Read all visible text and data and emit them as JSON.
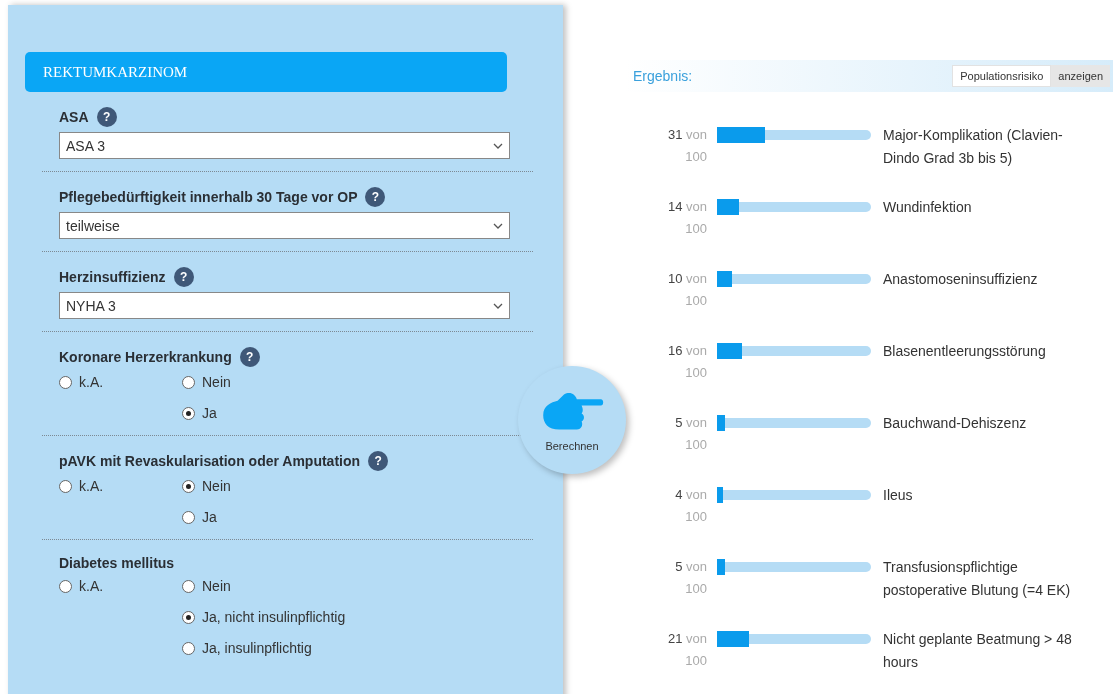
{
  "form": {
    "title": "REKTUMKARZINOM",
    "fields": [
      {
        "kind": "select",
        "label": "ASA",
        "help": "?",
        "value": "ASA 3"
      },
      {
        "kind": "select",
        "label": "Pflegebedürftigkeit innerhalb 30 Tage vor OP",
        "help": "?",
        "value": "teilweise"
      },
      {
        "kind": "select",
        "label": "Herzinsuffizienz",
        "help": "?",
        "value": "NYHA 3"
      },
      {
        "kind": "radio",
        "label": "Koronare Herzerkrankung",
        "help": "?",
        "options": [
          {
            "label": "k.A.",
            "selected": false
          },
          {
            "label": "Nein",
            "selected": false
          },
          {
            "label": "Ja",
            "selected": true
          }
        ]
      },
      {
        "kind": "radio",
        "label": "pAVK mit Revaskularisation oder Amputation",
        "help": "?",
        "options": [
          {
            "label": "k.A.",
            "selected": false
          },
          {
            "label": "Nein",
            "selected": true
          },
          {
            "label": "Ja",
            "selected": false
          }
        ]
      },
      {
        "kind": "radio",
        "label": "Diabetes mellitus",
        "options": [
          {
            "label": "k.A.",
            "selected": false
          },
          {
            "label": "Nein",
            "selected": false
          },
          {
            "label": "Ja, nicht insulinpflichtig",
            "selected": true
          },
          {
            "label": "Ja, insulinpflichtig",
            "selected": false
          }
        ]
      }
    ]
  },
  "calculate_button": "Berechnen",
  "result": {
    "title": "Ergebnis:",
    "population_label": "Populationsrisiko",
    "population_button": "anzeigen",
    "risks": [
      {
        "count": "31",
        "of": "von",
        "total": "100",
        "level": 0.31,
        "label": "Major-Komplikation (Clavien-Dindo Grad 3b bis 5)"
      },
      {
        "count": "14",
        "of": "von",
        "total": "100",
        "level": 0.14,
        "label": "Wundinfektion"
      },
      {
        "count": "10",
        "of": "von",
        "total": "100",
        "level": 0.1,
        "label": "Anastomoseninsuffizienz"
      },
      {
        "count": "16",
        "of": "von",
        "total": "100",
        "level": 0.16,
        "label": "Blasenentleerungsstörung"
      },
      {
        "count": "5",
        "of": "von",
        "total": "100",
        "level": 0.05,
        "label": "Bauchwand-Dehiszenz"
      },
      {
        "count": "4",
        "of": "von",
        "total": "100",
        "level": 0.04,
        "label": "Ileus"
      },
      {
        "count": "5",
        "of": "von",
        "total": "100",
        "level": 0.05,
        "label": "Transfusionspflichtige postoperative Blutung (=4 EK)"
      },
      {
        "count": "21",
        "of": "von",
        "total": "100",
        "level": 0.21,
        "label": "Nicht geplante Beatmung > 48 hours"
      }
    ]
  }
}
